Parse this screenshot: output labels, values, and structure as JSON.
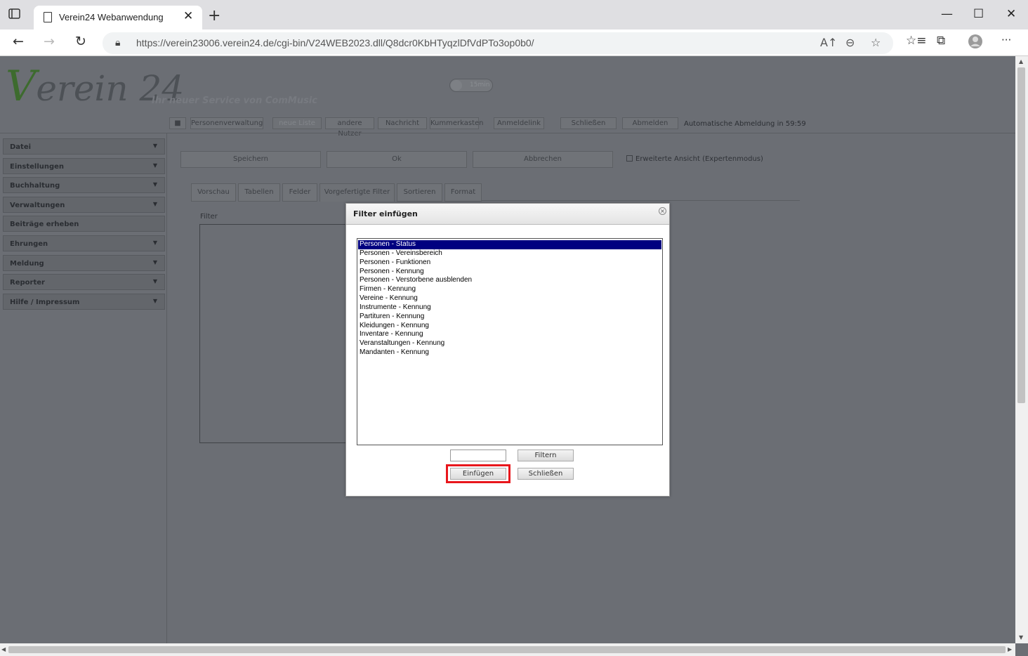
{
  "browser": {
    "tab_title": "Verein24 Webanwendung",
    "tab_close": "✕",
    "new_tab": "+",
    "url": "https://verein23006.verein24.de/cgi-bin/V24WEB2023.dll/Q8dcr0KbHTyqzlDfVdPTo3op0b0/",
    "back": "←",
    "forward": "→",
    "reload": "↻",
    "minimize": "—",
    "maximize": "☐",
    "close": "✕",
    "more": "···"
  },
  "header": {
    "logo_v": "V",
    "logo_rest": "erein 24",
    "tagline": "Ihr neuer Service von ComMusic",
    "timer": "15min",
    "buttons": [
      "Personenverwaltung",
      "neue Liste",
      "andere Nutzer",
      "Nachricht",
      "Kummerkasten",
      "Anmeldelink erst",
      "Schließen",
      "Abmelden"
    ],
    "auto_logout": "Automatische Abmeldung in 59:59"
  },
  "sidebar": {
    "items": [
      {
        "label": "Datei",
        "caret": "▼"
      },
      {
        "label": "Einstellungen",
        "caret": "▼"
      },
      {
        "label": "Buchhaltung",
        "caret": "▼"
      },
      {
        "label": "Verwaltungen",
        "caret": "▼"
      },
      {
        "label": "Beiträge erheben",
        "caret": ""
      },
      {
        "label": "Ehrungen",
        "caret": "▼"
      },
      {
        "label": "Meldung",
        "caret": "▼"
      },
      {
        "label": "Reporter",
        "caret": "▼"
      },
      {
        "label": "Hilfe / Impressum",
        "caret": "▼"
      }
    ]
  },
  "main": {
    "save": "Speichern",
    "ok": "Ok",
    "cancel": "Abbrechen",
    "expert_mode": "Erweiterte Ansicht (Expertenmodus)",
    "tabs": [
      "Vorschau",
      "Tabellen",
      "Felder",
      "Vorgefertigte Filter",
      "Sortieren",
      "Format"
    ],
    "filter_label": "Filter"
  },
  "dialog": {
    "title": "Filter einfügen",
    "close": "×",
    "items": [
      "Personen - Status",
      "Personen - Vereinsbereich",
      "Personen - Funktionen",
      "Personen - Kennung",
      "Personen - Verstorbene ausblenden",
      "Firmen - Kennung",
      "Vereine - Kennung",
      "Instrumente - Kennung",
      "Partituren - Kennung",
      "Kleidungen - Kennung",
      "Inventare - Kennung",
      "Veranstaltungen - Kennung",
      "Mandanten - Kennung"
    ],
    "selected_index": 0,
    "filter_input_value": "",
    "filter_button": "Filtern",
    "insert_button": "Einfügen",
    "close_button": "Schließen"
  },
  "colors": {
    "selection": "#000080",
    "highlight_border": "#e8161c",
    "overlay": "#6b6e74"
  }
}
